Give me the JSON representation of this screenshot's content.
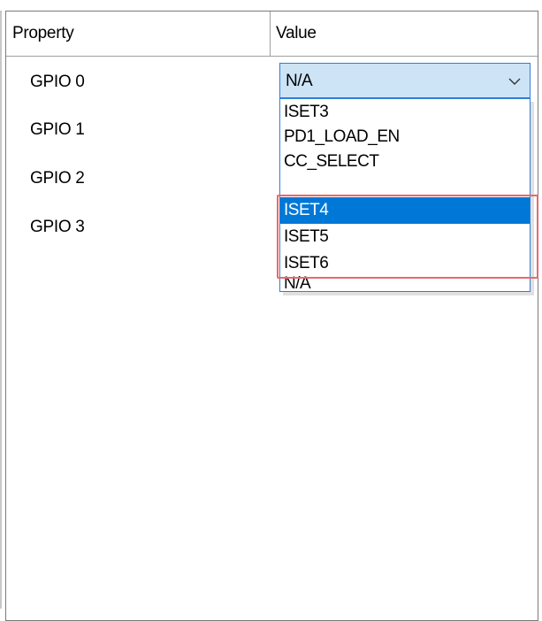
{
  "grid": {
    "columns": [
      "Property",
      "Value"
    ]
  },
  "properties": [
    {
      "name": "GPIO 0"
    },
    {
      "name": "GPIO 1"
    },
    {
      "name": "GPIO 2"
    },
    {
      "name": "GPIO 3"
    }
  ],
  "combo": {
    "value": "N/A",
    "icon": "chevron-down-icon"
  },
  "dropdown": {
    "options": [
      "ISET3",
      "PD1_LOAD_EN",
      "CC_SELECT",
      "ISET4",
      "ISET5",
      "ISET6",
      "N/A"
    ],
    "selected": "ISET4"
  },
  "colors": {
    "selection": "#0078d7",
    "combo_bg": "#cde4f7",
    "combo_border": "#2f7ed8",
    "annotation": "#e8696f"
  }
}
